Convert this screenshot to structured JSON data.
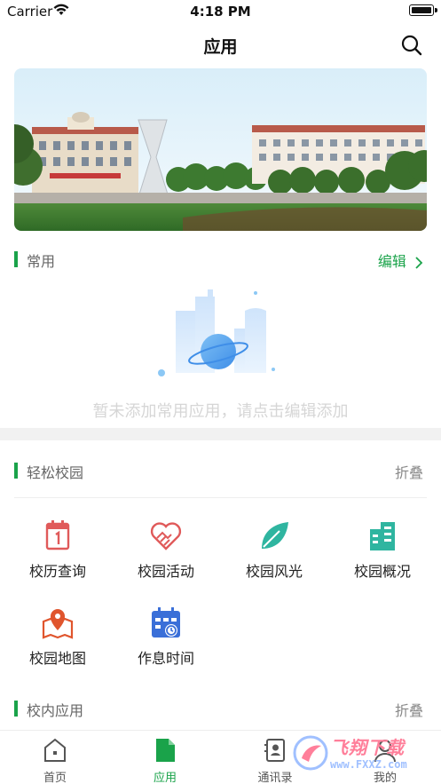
{
  "status_bar": {
    "carrier": "Carrier",
    "time": "4:18 PM"
  },
  "nav": {
    "title": "应用",
    "search_icon": "search-icon"
  },
  "banner": {
    "description_icon": "campus-photo"
  },
  "common_section": {
    "title": "常用",
    "action": "编辑",
    "empty_text": "暂未添加常用应用，请点击编辑添加"
  },
  "easy_campus": {
    "title": "轻松校园",
    "action": "折叠",
    "apps": [
      {
        "label": "校历查询",
        "icon": "calendar-icon",
        "color": "#e05a5a"
      },
      {
        "label": "校园活动",
        "icon": "heart-handshake-icon",
        "color": "#e05a5a"
      },
      {
        "label": "校园风光",
        "icon": "leaf-icon",
        "color": "#2fb5a0"
      },
      {
        "label": "校园概况",
        "icon": "building-icon",
        "color": "#2fb5a0"
      },
      {
        "label": "校园地图",
        "icon": "map-pin-icon",
        "color": "#e0552d"
      },
      {
        "label": "作息时间",
        "icon": "schedule-icon",
        "color": "#3a6fd8"
      }
    ]
  },
  "internal_section": {
    "title": "校内应用",
    "action": "折叠"
  },
  "tab_bar": {
    "tabs": [
      {
        "label": "首页",
        "icon": "home-icon"
      },
      {
        "label": "应用",
        "icon": "document-icon",
        "active": true
      },
      {
        "label": "通讯录",
        "icon": "contacts-icon"
      },
      {
        "label": "我的",
        "icon": "profile-icon"
      }
    ]
  },
  "watermark": {
    "text": "飞翔下载",
    "url": "www.FXXZ.com"
  },
  "colors": {
    "accent": "#1aa34a"
  }
}
